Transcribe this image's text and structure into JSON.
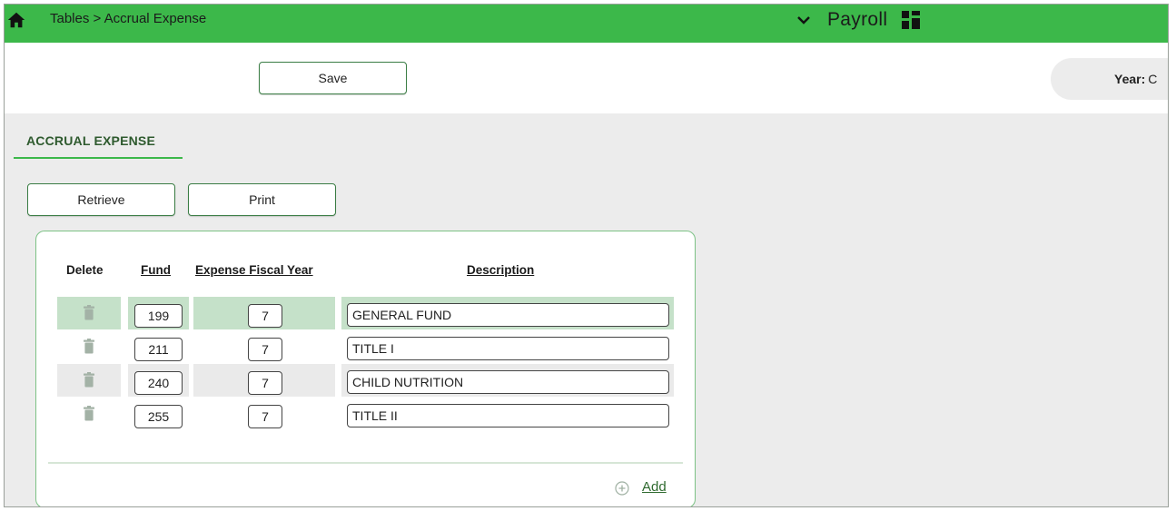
{
  "topbar": {
    "breadcrumb": "Tables > Accrual Expense",
    "module": "Payroll",
    "bar_color": "#3cb84a"
  },
  "toolbar": {
    "save_label": "Save",
    "year_label": "Year:",
    "year_value": "C"
  },
  "section": {
    "title": "ACCRUAL EXPENSE"
  },
  "actions": {
    "retrieve_label": "Retrieve",
    "print_label": "Print"
  },
  "table": {
    "headers": {
      "delete": "Delete",
      "fund": "Fund",
      "expense_fiscal_year": "Expense Fiscal Year",
      "description": "Description"
    },
    "rows": [
      {
        "fund": "199",
        "fiscal_year": "7",
        "description": "GENERAL FUND",
        "selected": true
      },
      {
        "fund": "211",
        "fiscal_year": "7",
        "description": "TITLE I",
        "selected": false
      },
      {
        "fund": "240",
        "fiscal_year": "7",
        "description": "CHILD NUTRITION",
        "selected": false
      },
      {
        "fund": "255",
        "fiscal_year": "7",
        "description": "TITLE II",
        "selected": false
      }
    ],
    "add_label": "Add",
    "selected_row_color": "#c5e1c9",
    "alt_row_color": "#eaeaea"
  },
  "icons": {
    "home": "home-icon",
    "module_dropdown": "chevron-down-icon",
    "apps": "grid-icon",
    "delete": "trash-icon",
    "add": "plus-circle-icon"
  }
}
